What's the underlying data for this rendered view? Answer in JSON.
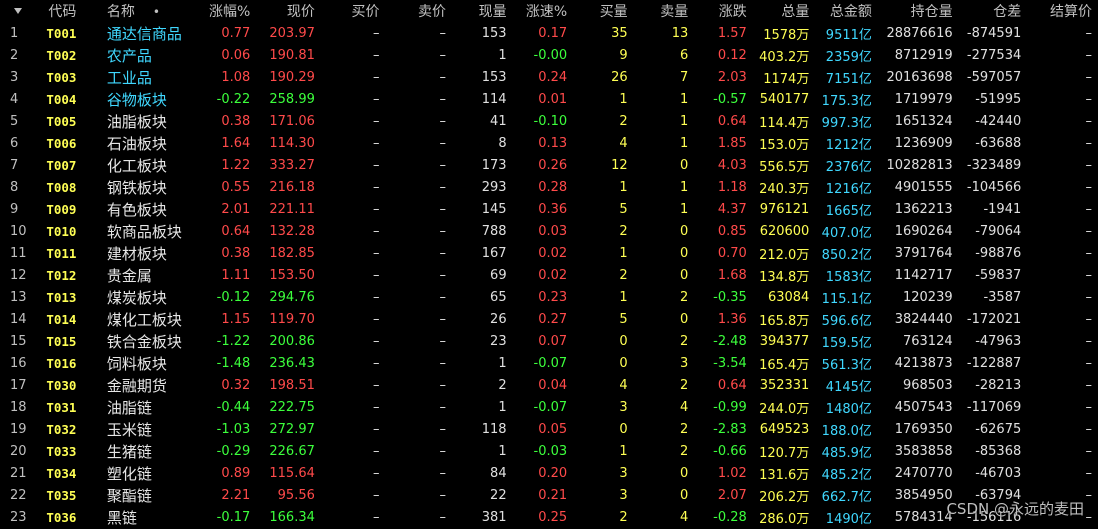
{
  "headers": [
    "代码",
    "名称",
    "涨幅%",
    "现价",
    "买价",
    "卖价",
    "现量",
    "涨速%",
    "买量",
    "卖量",
    "涨跌",
    "总量",
    "总金额",
    "持仓量",
    "仓差",
    "结算价"
  ],
  "watermark": "CSDN @永远的麦田",
  "colors": {
    "up": "#ff4a4a",
    "down": "#3cff3c",
    "code": "#ffff54",
    "amount": "#40d8ff"
  },
  "rows": [
    {
      "i": "1",
      "code": "T001",
      "name": "通达信商品",
      "name_color": "cyan",
      "chg": "0.77",
      "price": "203.97",
      "bid": "–",
      "ask": "–",
      "cur": "153",
      "spd": "0.17",
      "bq": "35",
      "aq": "13",
      "diff": "1.57",
      "vol": "1578万",
      "amt": "9511亿",
      "oi": "28876616",
      "oichg": "-874591",
      "settle": "–",
      "up": true
    },
    {
      "i": "2",
      "code": "T002",
      "name": "农产品",
      "name_color": "cyan",
      "chg": "0.06",
      "price": "190.81",
      "bid": "–",
      "ask": "–",
      "cur": "1",
      "spd": "-0.00",
      "bq": "9",
      "aq": "6",
      "diff": "0.12",
      "vol": "403.2万",
      "amt": "2359亿",
      "oi": "8712919",
      "oichg": "-277534",
      "settle": "–",
      "up": true,
      "spd_down": true
    },
    {
      "i": "3",
      "code": "T003",
      "name": "工业品",
      "name_color": "cyan",
      "chg": "1.08",
      "price": "190.29",
      "bid": "–",
      "ask": "–",
      "cur": "153",
      "spd": "0.24",
      "bq": "26",
      "aq": "7",
      "diff": "2.03",
      "vol": "1174万",
      "amt": "7151亿",
      "oi": "20163698",
      "oichg": "-597057",
      "settle": "–",
      "up": true
    },
    {
      "i": "4",
      "code": "T004",
      "name": "谷物板块",
      "name_color": "cyan",
      "chg": "-0.22",
      "price": "258.99",
      "bid": "–",
      "ask": "–",
      "cur": "114",
      "spd": "0.01",
      "bq": "1",
      "aq": "1",
      "diff": "-0.57",
      "vol": "540177",
      "amt": "175.3亿",
      "oi": "1719979",
      "oichg": "-51995",
      "settle": "–",
      "up": false
    },
    {
      "i": "5",
      "code": "T005",
      "name": "油脂板块",
      "name_color": "white",
      "chg": "0.38",
      "price": "171.06",
      "bid": "–",
      "ask": "–",
      "cur": "41",
      "spd": "-0.10",
      "bq": "2",
      "aq": "1",
      "diff": "0.64",
      "vol": "114.4万",
      "amt": "997.3亿",
      "oi": "1651324",
      "oichg": "-42440",
      "settle": "–",
      "up": true,
      "spd_down": true
    },
    {
      "i": "6",
      "code": "T006",
      "name": "石油板块",
      "name_color": "white",
      "chg": "1.64",
      "price": "114.30",
      "bid": "–",
      "ask": "–",
      "cur": "8",
      "spd": "0.13",
      "bq": "4",
      "aq": "1",
      "diff": "1.85",
      "vol": "153.0万",
      "amt": "1212亿",
      "oi": "1236909",
      "oichg": "-63688",
      "settle": "–",
      "up": true
    },
    {
      "i": "7",
      "code": "T007",
      "name": "化工板块",
      "name_color": "white",
      "chg": "1.22",
      "price": "333.27",
      "bid": "–",
      "ask": "–",
      "cur": "173",
      "spd": "0.26",
      "bq": "12",
      "aq": "0",
      "diff": "4.03",
      "vol": "556.5万",
      "amt": "2376亿",
      "oi": "10282813",
      "oichg": "-323489",
      "settle": "–",
      "up": true
    },
    {
      "i": "8",
      "code": "T008",
      "name": "钢铁板块",
      "name_color": "white",
      "chg": "0.55",
      "price": "216.18",
      "bid": "–",
      "ask": "–",
      "cur": "293",
      "spd": "0.28",
      "bq": "1",
      "aq": "1",
      "diff": "1.18",
      "vol": "240.3万",
      "amt": "1216亿",
      "oi": "4901555",
      "oichg": "-104566",
      "settle": "–",
      "up": true
    },
    {
      "i": "9",
      "code": "T009",
      "name": "有色板块",
      "name_color": "white",
      "chg": "2.01",
      "price": "221.11",
      "bid": "–",
      "ask": "–",
      "cur": "145",
      "spd": "0.36",
      "bq": "5",
      "aq": "1",
      "diff": "4.37",
      "vol": "976121",
      "amt": "1665亿",
      "oi": "1362213",
      "oichg": "-1941",
      "settle": "–",
      "up": true
    },
    {
      "i": "10",
      "code": "T010",
      "name": "软商品板块",
      "name_color": "white",
      "chg": "0.64",
      "price": "132.28",
      "bid": "–",
      "ask": "–",
      "cur": "788",
      "spd": "0.03",
      "bq": "2",
      "aq": "0",
      "diff": "0.85",
      "vol": "620600",
      "amt": "407.0亿",
      "oi": "1690264",
      "oichg": "-79064",
      "settle": "–",
      "up": true
    },
    {
      "i": "11",
      "code": "T011",
      "name": "建材板块",
      "name_color": "white",
      "chg": "0.38",
      "price": "182.85",
      "bid": "–",
      "ask": "–",
      "cur": "167",
      "spd": "0.02",
      "bq": "1",
      "aq": "0",
      "diff": "0.70",
      "vol": "212.0万",
      "amt": "850.2亿",
      "oi": "3791764",
      "oichg": "-98876",
      "settle": "–",
      "up": true
    },
    {
      "i": "12",
      "code": "T012",
      "name": "贵金属",
      "name_color": "white",
      "chg": "1.11",
      "price": "153.50",
      "bid": "–",
      "ask": "–",
      "cur": "69",
      "spd": "0.02",
      "bq": "2",
      "aq": "0",
      "diff": "1.68",
      "vol": "134.8万",
      "amt": "1583亿",
      "oi": "1142717",
      "oichg": "-59837",
      "settle": "–",
      "up": true
    },
    {
      "i": "13",
      "code": "T013",
      "name": "煤炭板块",
      "name_color": "white",
      "chg": "-0.12",
      "price": "294.76",
      "bid": "–",
      "ask": "–",
      "cur": "65",
      "spd": "0.23",
      "bq": "1",
      "aq": "2",
      "diff": "-0.35",
      "vol": "63084",
      "amt": "115.1亿",
      "oi": "120239",
      "oichg": "-3587",
      "settle": "–",
      "up": false
    },
    {
      "i": "14",
      "code": "T014",
      "name": "煤化工板块",
      "name_color": "white",
      "chg": "1.15",
      "price": "119.70",
      "bid": "–",
      "ask": "–",
      "cur": "26",
      "spd": "0.27",
      "bq": "5",
      "aq": "0",
      "diff": "1.36",
      "vol": "165.8万",
      "amt": "596.6亿",
      "oi": "3824440",
      "oichg": "-172021",
      "settle": "–",
      "up": true
    },
    {
      "i": "15",
      "code": "T015",
      "name": "铁合金板块",
      "name_color": "white",
      "chg": "-1.22",
      "price": "200.86",
      "bid": "–",
      "ask": "–",
      "cur": "23",
      "spd": "0.07",
      "bq": "0",
      "aq": "2",
      "diff": "-2.48",
      "vol": "394377",
      "amt": "159.5亿",
      "oi": "763124",
      "oichg": "-47963",
      "settle": "–",
      "up": false
    },
    {
      "i": "16",
      "code": "T016",
      "name": "饲料板块",
      "name_color": "white",
      "chg": "-1.48",
      "price": "236.43",
      "bid": "–",
      "ask": "–",
      "cur": "1",
      "spd": "-0.07",
      "bq": "0",
      "aq": "3",
      "diff": "-3.54",
      "vol": "165.4万",
      "amt": "561.3亿",
      "oi": "4213873",
      "oichg": "-122887",
      "settle": "–",
      "up": false,
      "spd_down": true
    },
    {
      "i": "17",
      "code": "T030",
      "name": "金融期货",
      "name_color": "white",
      "chg": "0.32",
      "price": "198.51",
      "bid": "–",
      "ask": "–",
      "cur": "2",
      "spd": "0.04",
      "bq": "4",
      "aq": "2",
      "diff": "0.64",
      "vol": "352331",
      "amt": "4145亿",
      "oi": "968503",
      "oichg": "-28213",
      "settle": "–",
      "up": true
    },
    {
      "i": "18",
      "code": "T031",
      "name": "油脂链",
      "name_color": "white",
      "chg": "-0.44",
      "price": "222.75",
      "bid": "–",
      "ask": "–",
      "cur": "1",
      "spd": "-0.07",
      "bq": "3",
      "aq": "4",
      "diff": "-0.99",
      "vol": "244.0万",
      "amt": "1480亿",
      "oi": "4507543",
      "oichg": "-117069",
      "settle": "–",
      "up": false,
      "spd_down": true
    },
    {
      "i": "19",
      "code": "T032",
      "name": "玉米链",
      "name_color": "white",
      "chg": "-1.03",
      "price": "272.97",
      "bid": "–",
      "ask": "–",
      "cur": "118",
      "spd": "0.05",
      "bq": "0",
      "aq": "2",
      "diff": "-2.83",
      "vol": "649523",
      "amt": "188.0亿",
      "oi": "1769350",
      "oichg": "-62675",
      "settle": "–",
      "up": false
    },
    {
      "i": "20",
      "code": "T033",
      "name": "生猪链",
      "name_color": "white",
      "chg": "-0.29",
      "price": "226.67",
      "bid": "–",
      "ask": "–",
      "cur": "1",
      "spd": "-0.03",
      "bq": "1",
      "aq": "2",
      "diff": "-0.66",
      "vol": "120.7万",
      "amt": "485.9亿",
      "oi": "3583858",
      "oichg": "-85368",
      "settle": "–",
      "up": false,
      "spd_down": true
    },
    {
      "i": "21",
      "code": "T034",
      "name": "塑化链",
      "name_color": "white",
      "chg": "0.89",
      "price": "115.64",
      "bid": "–",
      "ask": "–",
      "cur": "84",
      "spd": "0.20",
      "bq": "3",
      "aq": "0",
      "diff": "1.02",
      "vol": "131.6万",
      "amt": "485.2亿",
      "oi": "2470770",
      "oichg": "-46703",
      "settle": "–",
      "up": true
    },
    {
      "i": "22",
      "code": "T035",
      "name": "聚酯链",
      "name_color": "white",
      "chg": "2.21",
      "price": "95.56",
      "bid": "–",
      "ask": "–",
      "cur": "22",
      "spd": "0.21",
      "bq": "3",
      "aq": "0",
      "diff": "2.07",
      "vol": "206.2万",
      "amt": "662.7亿",
      "oi": "3854950",
      "oichg": "-63794",
      "settle": "–",
      "up": true
    },
    {
      "i": "23",
      "code": "T036",
      "name": "黑链",
      "name_color": "white",
      "chg": "-0.17",
      "price": "166.34",
      "bid": "–",
      "ask": "–",
      "cur": "381",
      "spd": "0.25",
      "bq": "2",
      "aq": "4",
      "diff": "-0.28",
      "vol": "286.0万",
      "amt": "1490亿",
      "oi": "5784314",
      "oichg": "-156116",
      "settle": "–",
      "up": false
    }
  ]
}
